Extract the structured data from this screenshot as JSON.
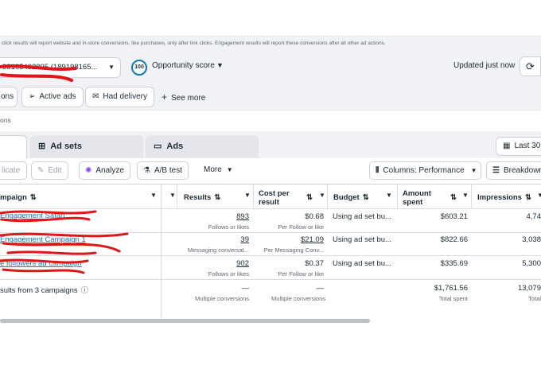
{
  "notice": "click results will report website and in-store conversions, like purchases, only after link clicks. Engagement results will report these conversions after all other ad actions.",
  "header": {
    "account": "98165492895 (189198165...",
    "opportunity_score": "100",
    "opportunity_label": "Opportunity score",
    "updated": "Updated just now",
    "refresh_icon": "refresh-icon"
  },
  "filters": {
    "chip_partial": "ons",
    "active_ads": "Active ads",
    "had_delivery": "Had delivery",
    "see_more": "See more"
  },
  "breadcrumb": "ons",
  "tabs": {
    "ad_sets": "Ad sets",
    "ads": "Ads",
    "date_range": "Last 30"
  },
  "toolbar": {
    "duplicate": "licate",
    "edit": "Edit",
    "analyze": "Analyze",
    "ab_test": "A/B test",
    "more": "More",
    "columns": "Columns: Performance",
    "breakdown": "Breakdown"
  },
  "columns": {
    "campaign": "mpaign",
    "results": "Results",
    "cost_per_result": "Cost per result",
    "budget": "Budget",
    "amount_spent": "Amount spent",
    "impressions": "Impressions"
  },
  "rows": [
    {
      "name": "Engagement Safari",
      "results": "893",
      "results_sub": "Follows or likes",
      "cost": "$0.68",
      "cost_sub": "Per Follow or like",
      "budget": "Using ad set bu...",
      "spent": "$603.21",
      "impressions": "4,74"
    },
    {
      "name": "Engagement Campaign 1",
      "results": "39",
      "results_sub": "Messaging conversat...",
      "cost": "$21.09",
      "cost_sub": "Per Messaging Conv...",
      "budget": "Using ad set bu...",
      "spent": "$822.66",
      "impressions": "3,038"
    },
    {
      "name": "e followers ad campaign",
      "results": "902",
      "results_sub": "Follows or likes",
      "cost": "$0.37",
      "cost_sub": "Per Follow or like",
      "budget": "Using ad set bu...",
      "spent": "$335.69",
      "impressions": "5,300"
    }
  ],
  "totals": {
    "label": "sults from 3 campaigns",
    "results": "—",
    "results_sub": "Multiple conversions",
    "cost": "—",
    "cost_sub": "Multiple conversions",
    "spent": "$1,761.56",
    "spent_sub": "Total spent",
    "impressions": "13,079",
    "impressions_sub": "Total"
  },
  "colors": {
    "accent": "#0a78be",
    "scribble": "#e0161b",
    "panel": "#f0f2f5"
  }
}
